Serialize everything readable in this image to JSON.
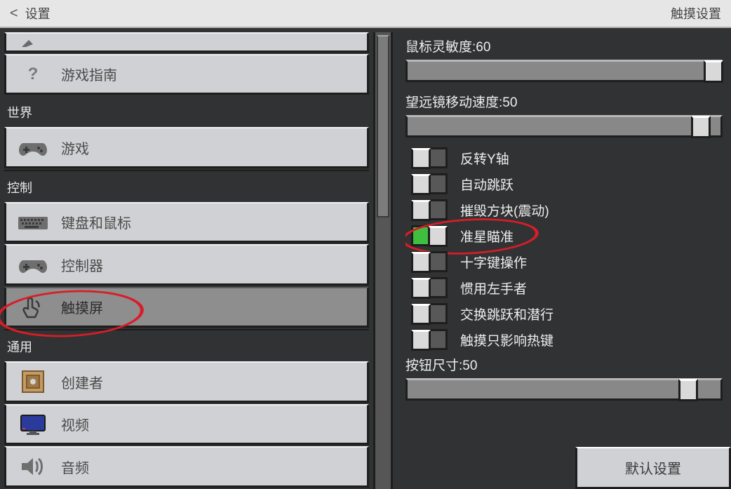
{
  "header": {
    "back_glyph": "<",
    "title": "设置",
    "right_title": "触摸设置"
  },
  "sidebar": {
    "top_cut_label": "",
    "guide_label": "游戏指南",
    "sections": {
      "world": {
        "head": "世界",
        "game": "游戏"
      },
      "control": {
        "head": "控制",
        "keyboard_mouse": "键盘和鼠标",
        "controller": "控制器",
        "touchscreen": "触摸屏"
      },
      "general": {
        "head": "通用",
        "creator": "创建者",
        "video": "视频",
        "audio": "音频"
      }
    }
  },
  "panel": {
    "sliders": {
      "mouse_sensitivity": {
        "label": "鼠标灵敏度:60",
        "value": 60,
        "min": 0,
        "max": 100
      },
      "spyglass_speed": {
        "label": "望远镜移动速度:50",
        "value": 50,
        "min": 0,
        "max": 100
      },
      "button_size": {
        "label": "按钮尺寸:50",
        "value": 50,
        "min": 0,
        "max": 100
      }
    },
    "toggles": {
      "invert_y": {
        "label": "反转Y轴",
        "on": false
      },
      "auto_jump": {
        "label": "自动跳跃",
        "on": false
      },
      "destroy_vib": {
        "label": "摧毁方块(震动)",
        "on": false
      },
      "crosshair_aim": {
        "label": "准星瞄准",
        "on": true
      },
      "dpad": {
        "label": "十字键操作",
        "on": false
      },
      "left_handed": {
        "label": "惯用左手者",
        "on": false
      },
      "swap_jump": {
        "label": "交换跳跃和潜行",
        "on": false
      },
      "touch_hotkey": {
        "label": "触摸只影响热键",
        "on": false
      }
    },
    "default_btn": "默认设置"
  },
  "colors": {
    "accent_on": "#3fbf3f",
    "highlight": "#d81d28"
  }
}
